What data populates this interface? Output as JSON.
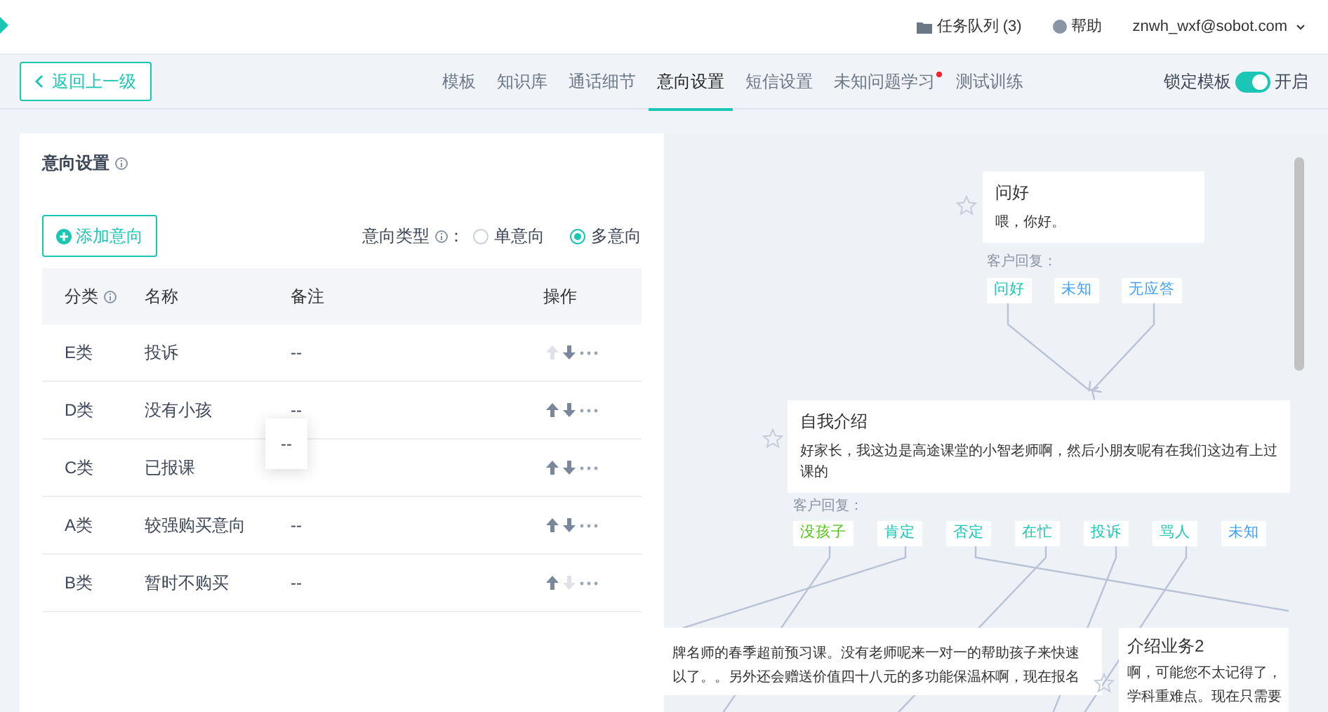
{
  "header": {
    "task_queue": "任务队列 (3)",
    "help": "帮助",
    "account": "znwh_wxf@sobot.com"
  },
  "nav": {
    "back": "返回上一级",
    "tabs": [
      {
        "label": "模板",
        "selected": false,
        "dot": false
      },
      {
        "label": "知识库",
        "selected": false,
        "dot": false
      },
      {
        "label": "通话细节",
        "selected": false,
        "dot": false
      },
      {
        "label": "意向设置",
        "selected": true,
        "dot": false
      },
      {
        "label": "短信设置",
        "selected": false,
        "dot": false
      },
      {
        "label": "未知问题学习",
        "selected": false,
        "dot": true
      },
      {
        "label": "测试训练",
        "selected": false,
        "dot": false
      }
    ],
    "lock_label": "锁定模板",
    "lock_on": true,
    "lock_state": "开启"
  },
  "panel": {
    "title": "意向设置",
    "add_button": "添加意向",
    "type_label": "意向类型",
    "type_colon": "：",
    "type_options": [
      {
        "label": "单意向",
        "selected": false
      },
      {
        "label": "多意向",
        "selected": true
      }
    ],
    "columns": [
      "分类",
      "名称",
      "备注",
      "操作"
    ],
    "rows": [
      {
        "category": "E类",
        "name": "投诉",
        "remark": "--",
        "up_disabled": true,
        "down_disabled": false
      },
      {
        "category": "D类",
        "name": "没有小孩",
        "remark": "--",
        "up_disabled": false,
        "down_disabled": false
      },
      {
        "category": "C类",
        "name": "已报课",
        "up_disabled": false,
        "down_disabled": false
      },
      {
        "category": "A类",
        "name": "较强购买意向",
        "remark": "--",
        "up_disabled": false,
        "down_disabled": false
      },
      {
        "category": "B类",
        "name": "暂时不购买",
        "remark": "--",
        "up_disabled": false,
        "down_disabled": true
      }
    ],
    "tooltip": {
      "text": "--"
    }
  },
  "flow": {
    "nodes": [
      {
        "title": "问好",
        "text": "喂，你好。",
        "reply_label": "客户回复：",
        "replies": [
          {
            "label": "问好",
            "color": "#1bc6b4"
          },
          {
            "label": "未知",
            "color": "#409eff"
          },
          {
            "label": "无应答",
            "color": "#409eff"
          }
        ]
      },
      {
        "title": "自我介绍",
        "text": "好家长，我这边是高途课堂的小智老师啊，然后小朋友呢有在我们这边有上过课的",
        "reply_label": "客户回复：",
        "replies": [
          {
            "label": "没孩子",
            "color": "#52c41a"
          },
          {
            "label": "肯定",
            "color": "#1bc6b4"
          },
          {
            "label": "否定",
            "color": "#1bc6b4"
          },
          {
            "label": "在忙",
            "color": "#1bc6b4"
          },
          {
            "label": "投诉",
            "color": "#1bc6b4"
          },
          {
            "label": "骂人",
            "color": "#1bc6b4"
          },
          {
            "label": "未知",
            "color": "#409eff"
          }
        ]
      },
      {
        "lines": [
          "牌名师的春季超前预习课。没有老师呢来一对一的帮助孩子来快速",
          "以了。。另外还会赠送价值四十八元的多功能保温杯啊，现在报名"
        ]
      },
      {
        "title": "介绍业务2",
        "lines": [
          "啊，可能您不太记得了，",
          "学科重难点。现在只需要"
        ]
      }
    ]
  }
}
